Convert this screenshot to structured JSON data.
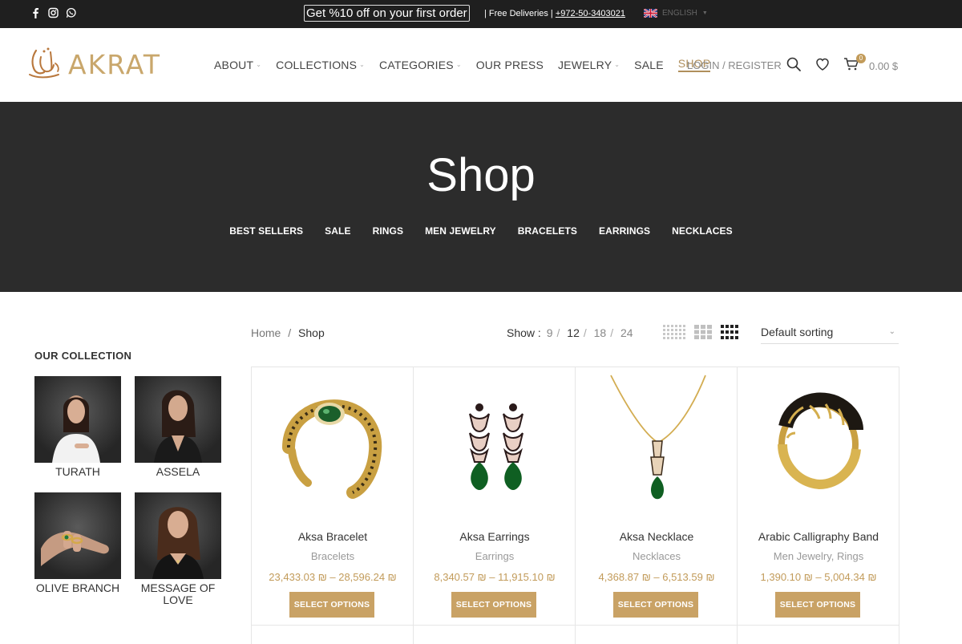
{
  "topbar": {
    "promo": "Get %10 off on your first order",
    "deliveries": "| Free Deliveries |",
    "phone": "+972-50-3403021",
    "language": "ENGLISH",
    "social_icons": [
      "facebook-icon",
      "instagram-icon",
      "whatsapp-icon"
    ]
  },
  "header": {
    "logo_text": "AKRAT",
    "nav": [
      {
        "label": "ABOUT",
        "dropdown": true
      },
      {
        "label": "COLLECTIONS",
        "dropdown": true
      },
      {
        "label": "CATEGORIES",
        "dropdown": true
      },
      {
        "label": "OUR PRESS",
        "dropdown": false
      },
      {
        "label": "JEWELRY",
        "dropdown": true
      },
      {
        "label": "SALE",
        "dropdown": false
      },
      {
        "label": "SHOP",
        "dropdown": false,
        "active": true
      }
    ],
    "login": "LOGIN / REGISTER",
    "cart_count": "0",
    "cart_total": "0.00 $"
  },
  "banner": {
    "title": "Shop",
    "categories": [
      "BEST SELLERS",
      "SALE",
      "RINGS",
      "MEN JEWELRY",
      "BRACELETS",
      "EARRINGS",
      "NECKLACES"
    ]
  },
  "sidebar": {
    "title": "OUR COLLECTION",
    "collections": [
      "TURATH",
      "ASSELA",
      "OLIVE BRANCH",
      "MESSAGE OF LOVE"
    ]
  },
  "toolbar": {
    "breadcrumb_home": "Home",
    "breadcrumb_sep": "/",
    "breadcrumb_current": "Shop",
    "show_label": "Show :",
    "show_options": [
      "9",
      "12",
      "18",
      "24"
    ],
    "show_selected": "12",
    "sort": "Default sorting"
  },
  "products": [
    {
      "name": "Aksa Bracelet",
      "category": "Bracelets",
      "price": "23,433.03 ₪ – 28,596.24 ₪",
      "button": "SELECT OPTIONS"
    },
    {
      "name": "Aksa Earrings",
      "category": "Earrings",
      "price": "8,340.57 ₪ – 11,915.10 ₪",
      "button": "SELECT OPTIONS"
    },
    {
      "name": "Aksa Necklace",
      "category": "Necklaces",
      "price": "4,368.87 ₪ – 6,513.59 ₪",
      "button": "SELECT OPTIONS"
    },
    {
      "name": "Arabic Calligraphy Band",
      "category": "Men Jewelry, Rings",
      "price": "1,390.10 ₪ – 5,004.34 ₪",
      "button": "SELECT OPTIONS"
    }
  ],
  "colors": {
    "accent": "#c29b5a",
    "button": "#c9a265",
    "banner": "#2c2c2c",
    "topbar": "#1f1f1f"
  }
}
